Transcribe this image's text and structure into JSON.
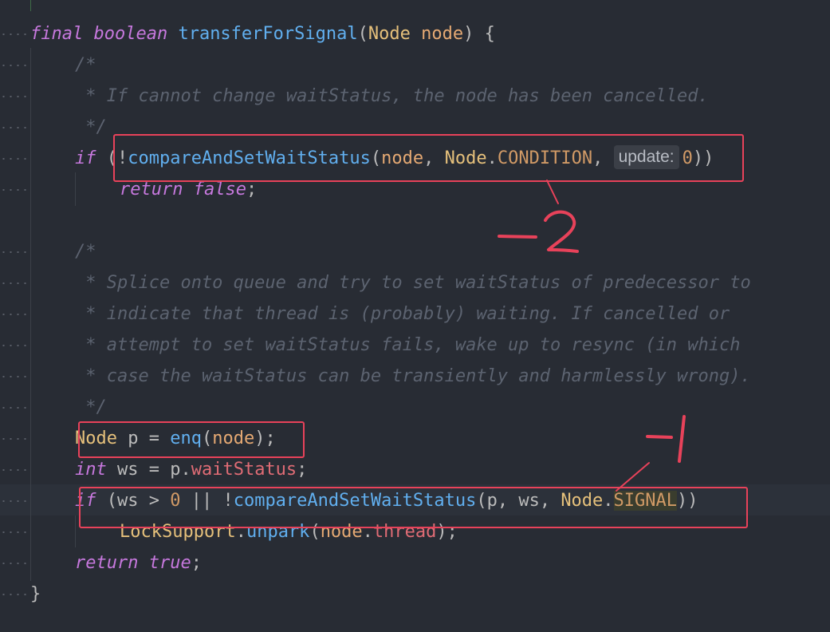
{
  "code": {
    "l1": {
      "final": "final",
      "boolean": "boolean",
      "name": "transferForSignal",
      "open": "(",
      "type": "Node",
      "param": "node",
      "close": ") {"
    },
    "l2": "/*",
    "l3": " * If cannot change waitStatus, the node has been cancelled.",
    "l4": " */",
    "l5": {
      "if": "if",
      "a": " (!",
      "fn": "compareAndSetWaitStatus",
      "b": "(",
      "node": "node",
      "c": ", ",
      "Node": "Node",
      "dot": ".",
      "const": "CONDITION",
      "d": ", ",
      "hint": "update:",
      "zero": "0",
      "e": "))"
    },
    "l6": {
      "return": "return",
      "false": "false",
      "semi": ";"
    },
    "l8": "/*",
    "l9": " * Splice onto queue and try to set waitStatus of predecessor to",
    "l10": " * indicate that thread is (probably) waiting. If cancelled or",
    "l11": " * attempt to set waitStatus fails, wake up to resync (in which",
    "l12": " * case the waitStatus can be transiently and harmlessly wrong).",
    "l13": " */",
    "l14": {
      "type": "Node",
      "a": " p = ",
      "fn": "enq",
      "b": "(",
      "node": "node",
      "c": ");"
    },
    "l15": {
      "int": "int",
      "a": " ws = p.",
      "field": "waitStatus",
      "b": ";"
    },
    "l16": {
      "if": "if",
      "a": " (ws > ",
      "zero": "0",
      "b": " || !",
      "fn": "compareAndSetWaitStatus",
      "c": "(p, ws, ",
      "Node": "Node",
      "dot": ".",
      "const": "SIGNAL",
      "d": "))"
    },
    "l17": {
      "cls": "LockSupport",
      "dot": ".",
      "fn": "unpark",
      "a": "(",
      "node": "node",
      "dot2": ".",
      "field": "thread",
      "b": ");"
    },
    "l18": {
      "return": "return",
      "true": "true",
      "semi": ";"
    },
    "l19": "}"
  },
  "annotations": {
    "mark_top": "-2",
    "mark_bottom": "-1",
    "color": "#e8425a"
  },
  "theme": {
    "background": "#282c34",
    "keyword": "#c678dd",
    "function": "#61afef",
    "type": "#e5c07b",
    "comment": "#5c6370"
  }
}
